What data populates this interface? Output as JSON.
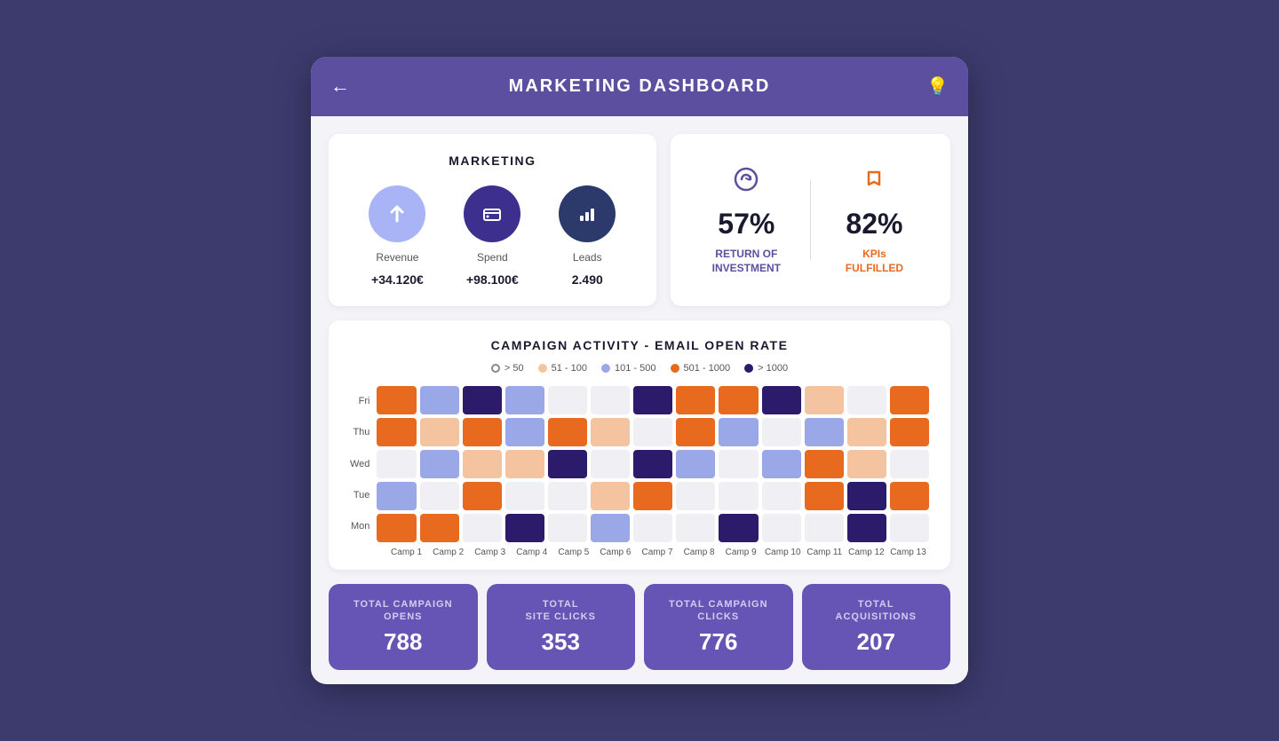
{
  "header": {
    "title": "MARKETING DASHBOARD",
    "back_label": "←",
    "icon": "💡"
  },
  "marketing": {
    "title": "MARKETING",
    "metrics": [
      {
        "id": "revenue",
        "label": "Revenue",
        "value": "+34.120€",
        "circle_class": "circle-light",
        "icon": "↑"
      },
      {
        "id": "spend",
        "label": "Spend",
        "value": "+98.100€",
        "circle_class": "circle-dark1",
        "icon": "💳"
      },
      {
        "id": "leads",
        "label": "Leads",
        "value": "2.490",
        "circle_class": "circle-dark2",
        "icon": "📊"
      }
    ]
  },
  "kpis": [
    {
      "id": "roi",
      "percent": "57%",
      "label": "RETURN OF\nINVESTMENT",
      "icon": "↻$",
      "color": "purple"
    },
    {
      "id": "kpis",
      "percent": "82%",
      "label": "KPIs\nFULFILLED",
      "icon": "⚑",
      "color": "orange"
    }
  ],
  "campaign": {
    "title": "CAMPAIGN ACTIVITY - EMAIL OPEN RATE",
    "legend": [
      {
        "type": "empty",
        "label": "> 50"
      },
      {
        "type": "dot",
        "class": "dot-peach",
        "label": "51 - 100"
      },
      {
        "type": "dot",
        "class": "dot-lilac",
        "label": "101 - 500"
      },
      {
        "type": "dot",
        "class": "dot-orange",
        "label": "501 - 1000"
      },
      {
        "type": "dot",
        "class": "dot-darkpurple",
        "label": "> 1000"
      }
    ],
    "rows": [
      "Fri",
      "Thu",
      "Wed",
      "Tue",
      "Mon"
    ],
    "cols": [
      "Camp 1",
      "Camp 2",
      "Camp 3",
      "Camp 4",
      "Camp 5",
      "Camp 6",
      "Camp 7",
      "Camp 8",
      "Camp 9",
      "Camp 10",
      "Camp 11",
      "Camp 12",
      "Camp 13"
    ],
    "cells": {
      "Fri": [
        "c-orange",
        "c-lilac",
        "c-darkpurple",
        "c-lilac",
        "c-empty",
        "c-empty",
        "c-darkpurple",
        "c-orange",
        "c-orange",
        "c-darkpurple",
        "c-peach",
        "c-empty",
        "c-orange",
        "c-peach"
      ],
      "Thu": [
        "c-orange",
        "c-peach",
        "c-orange",
        "c-lilac",
        "c-orange",
        "c-peach",
        "c-empty",
        "c-orange",
        "c-lilac",
        "c-empty",
        "c-lilac",
        "c-peach",
        "c-orange",
        "c-orange"
      ],
      "Wed": [
        "c-empty",
        "c-lilac",
        "c-peach",
        "c-peach",
        "c-darkpurple",
        "c-empty",
        "c-darkpurple",
        "c-lilac",
        "c-empty",
        "c-lilac",
        "c-orange",
        "c-peach",
        "c-empty",
        "c-orange"
      ],
      "Tue": [
        "c-lilac",
        "c-empty",
        "c-orange",
        "c-empty",
        "c-empty",
        "c-peach",
        "c-orange",
        "c-empty",
        "c-empty",
        "c-empty",
        "c-orange",
        "c-darkpurple",
        "c-orange",
        "c-peach"
      ],
      "Mon": [
        "c-orange",
        "c-orange",
        "c-empty",
        "c-darkpurple",
        "c-empty",
        "c-lilac",
        "c-empty",
        "c-empty",
        "c-darkpurple",
        "c-empty",
        "c-empty",
        "c-darkpurple",
        "c-empty",
        "c-empty"
      ]
    }
  },
  "bottom_stats": [
    {
      "id": "total-campaign-opens",
      "title": "TOTAL CAMPAIGN\nOPENS",
      "value": "788"
    },
    {
      "id": "total-site-clicks",
      "title": "TOTAL\nSITE CLICKS",
      "value": "353"
    },
    {
      "id": "total-campaign-clicks",
      "title": "TOTAL CAMPAIGN\nCLICKS",
      "value": "776"
    },
    {
      "id": "total-acquisitions",
      "title": "TOTAL\nACQUISITIONS",
      "value": "207"
    }
  ]
}
